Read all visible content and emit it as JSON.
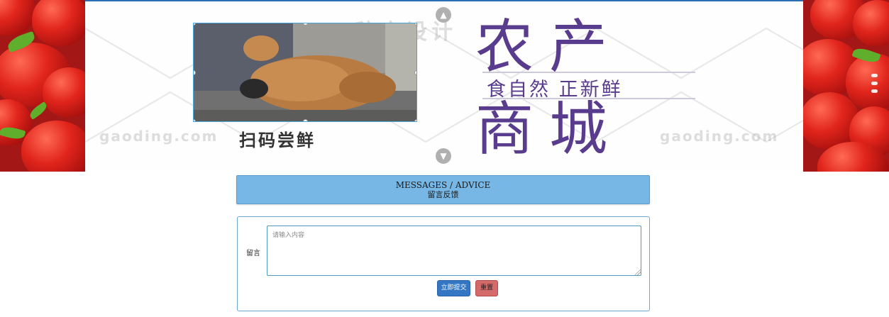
{
  "banner": {
    "watermark_top": "稿定设计",
    "watermark_left": "gaoding.com",
    "watermark_right": "gaoding.com",
    "scan_caption": "扫码尝鲜",
    "title_line1": "农产",
    "subtitle": "食自然 正新鲜",
    "title_line2": "商城",
    "nav_up_icon": "chevron-up-icon",
    "nav_down_icon": "chevron-down-icon"
  },
  "messages": {
    "header_en": "MESSAGES / ADVICE",
    "header_cn": "留言反馈"
  },
  "form": {
    "label": "留言",
    "textarea_placeholder": "请输入内容",
    "textarea_value": "",
    "submit_label": "立即提交",
    "reset_label": "重置"
  },
  "colors": {
    "title_purple": "#5a3c8e",
    "header_blue": "#77b7e5",
    "submit_blue": "#3377c4",
    "reset_red": "#d46a6a"
  }
}
